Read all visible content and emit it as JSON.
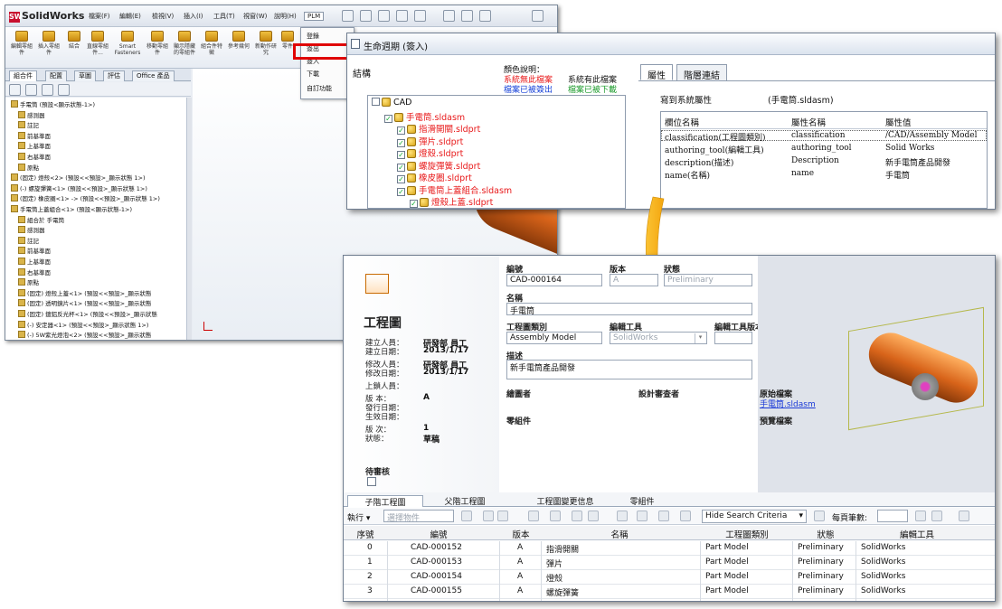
{
  "solidworks": {
    "app_name": "SolidWorks",
    "menu": [
      "檔案(F)",
      "編輯(E)",
      "檢視(V)",
      "插入(I)",
      "工具(T)",
      "視窗(W)",
      "說明(H)",
      "PLM"
    ],
    "ribbon": [
      "編輯零組件",
      "插入零組件",
      "結合",
      "直線零組件...",
      "Smart Fasteners",
      "移動零組件",
      "顯示隱藏的零組件",
      "組合件特徵",
      "參考幾何",
      "新動作研究",
      "零件"
    ],
    "plm_menu": [
      "登錄",
      "簽出",
      "簽入",
      "下載",
      "自訂功能"
    ],
    "panel_tabs": [
      "組合件",
      "配置",
      "草圖",
      "評估",
      "Office 產品"
    ],
    "tree": [
      "手電筒 (預設<顯示狀態-1>)",
      "感測器",
      "註記",
      "前基準面",
      "上基準面",
      "右基準面",
      "原點",
      "(固定) 燈殼<2> (預設<<預設>_顯示狀態 1>)",
      "(-) 螺旋彈簧<1> (預設<<預設>_顯示狀態 1>)",
      "(固定) 橡皮圈<1> -> (預設<<預設>_顯示狀態 1>)",
      "手電筒上蓋組合<1> (預設<顯示狀態-1>)",
      "組合於 手電筒",
      "感測器",
      "註記",
      "前基準面",
      "上基準面",
      "右基準面",
      "原點",
      "(固定) 燈殼上蓋<1> (預設<<預設>_顯示狀態",
      "(固定) 透明鏡片<1> (預設<<預設>_顯示狀態",
      "(固定) 鍍鋁反光杯<1> (預設<<預設>_顯示狀態",
      "(-) 安定器<1> (預設<<預設>_顯示狀態 1>)",
      "(-) 5W紫光燈泡<2> (預設<<預設>_顯示狀態"
    ]
  },
  "lifecycle": {
    "title": "生命週期 (簽入)",
    "structure_label": "結構",
    "legend_title": "顏色說明：",
    "legend": [
      {
        "text": "系統無此檔案",
        "color": "#e8191a"
      },
      {
        "text": "系統有此檔案",
        "color": "#111111"
      },
      {
        "text": "檔案已被簽出",
        "color": "#1540d8"
      },
      {
        "text": "檔案已被下載",
        "color": "#1a9a2a"
      }
    ],
    "tree": [
      {
        "label": "CAD",
        "red": false
      },
      {
        "label": "手電筒.sldasm",
        "red": true
      },
      {
        "label": "指滑開關.sldprt",
        "red": true
      },
      {
        "label": "彈片.sldprt",
        "red": true
      },
      {
        "label": "燈殼.sldprt",
        "red": true
      },
      {
        "label": "螺旋彈簧.sldprt",
        "red": true
      },
      {
        "label": "橡皮圈.sldprt",
        "red": true
      },
      {
        "label": "手電筒上蓋組合.sldasm",
        "red": true
      },
      {
        "label": "燈殼上蓋.sldprt",
        "red": true
      }
    ],
    "tabs": [
      "屬性",
      "階層連結"
    ],
    "write_to_label": "寫到系統屬性",
    "write_to_value": "(手電筒.sldasm)",
    "prop_headers": [
      "欄位名稱",
      "屬性名稱",
      "屬性值"
    ],
    "props": [
      {
        "field": "classification(工程圖類別)",
        "name": "classification",
        "value": "/CAD/Assembly Model"
      },
      {
        "field": "authoring_tool(編輯工具)",
        "name": "authoring_tool",
        "value": "Solid Works"
      },
      {
        "field": "description(描述)",
        "name": "Description",
        "value": "新手電筒產品開發"
      },
      {
        "field": "name(名稱)",
        "name": "name",
        "value": "手電筒"
      }
    ]
  },
  "form": {
    "title": "工程圖",
    "labels": {
      "number": "編號",
      "version": "版本",
      "status": "狀態",
      "name": "名稱",
      "category": "工程圖類別",
      "tool": "編輯工具",
      "tool_version": "編輯工具版本",
      "description": "描述",
      "drafter": "繪圖者",
      "designer": "設計審查者",
      "source_file": "原始檔案",
      "parts": "零組件",
      "preview_file": "預覽檔案",
      "pending_review": "待審核"
    },
    "values": {
      "number": "CAD-000164",
      "version": "A",
      "status": "Preliminary",
      "name": "手電筒",
      "category": "Assembly Model",
      "tool": "SolidWorks",
      "tool_version": "",
      "description": "新手電筒產品開發",
      "source_file": "手電筒.sldasm"
    },
    "meta": [
      {
        "label": "建立人員：",
        "value": "研發部 員工"
      },
      {
        "label": "建立日期：",
        "value": "2013/1/17"
      },
      {
        "label": "修改人員：",
        "value": "研發部 員工"
      },
      {
        "label": "修改日期：",
        "value": "2013/1/17"
      },
      {
        "label": "上鎖人員：",
        "value": ""
      },
      {
        "label": "版 本：",
        "value": "A"
      },
      {
        "label": "發行日期：",
        "value": ""
      },
      {
        "label": "生效日期：",
        "value": ""
      },
      {
        "label": "版 次：",
        "value": "1"
      },
      {
        "label": "狀態：",
        "value": "草稿"
      }
    ],
    "tabs": [
      "子階工程圖",
      "父階工程圖",
      "工程圖變更信息",
      "零組件"
    ],
    "toolbar": {
      "execute": "執行 ▾",
      "select_placeholder": "選擇物件",
      "search_mode": "Hide Search Criteria",
      "per_page_label": "每頁筆數:"
    },
    "grid_headers": [
      "序號",
      "編號",
      "版本",
      "名稱",
      "工程圖類別",
      "狀態",
      "編輯工具"
    ],
    "rows": [
      [
        "0",
        "CAD-000152",
        "A",
        "指滑開關",
        "Part Model",
        "Preliminary",
        "SolidWorks"
      ],
      [
        "1",
        "CAD-000153",
        "A",
        "彈片",
        "Part Model",
        "Preliminary",
        "SolidWorks"
      ],
      [
        "2",
        "CAD-000154",
        "A",
        "燈殼",
        "Part Model",
        "Preliminary",
        "SolidWorks"
      ],
      [
        "3",
        "CAD-000155",
        "A",
        "螺旋彈簧",
        "Part Model",
        "Preliminary",
        "SolidWorks"
      ]
    ]
  },
  "colors": {
    "accent_red": "#e00000",
    "torch_orange": "#d8641a",
    "arrow_yellow": "#f5b400",
    "link_blue": "#1a3ad8"
  }
}
